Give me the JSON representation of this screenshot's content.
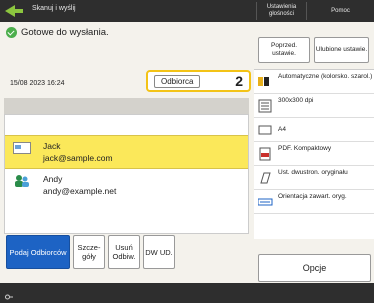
{
  "topbar": {
    "title": "Skanuj i wyślij",
    "settings_label": "Ustawienia głośności",
    "help_label": "Pomoc"
  },
  "status": {
    "text": "Gotowe do wysłania."
  },
  "datetime": "15/08 2023 16:24",
  "recipient": {
    "label": "Odbiorca",
    "count": "2"
  },
  "recipients": [
    {
      "name": "Jack",
      "address": "jack@sample.com",
      "selected": true
    },
    {
      "name": "Andy",
      "address": "andy@example.net",
      "selected": false
    }
  ],
  "bottom_buttons": {
    "specify": "Podaj Odbiorców",
    "details": "Szcze-góły",
    "delete": "Usuń Odbiw.",
    "cc_bcc": "DW UD."
  },
  "right_top": {
    "prev_settings": "Poprzed. ustawie.",
    "favorites": "Ulubione ustawie."
  },
  "settings": [
    {
      "icon": "color-mode-icon",
      "text": "Automatyczne (kolorsko. szarol.)"
    },
    {
      "icon": "resolution-icon",
      "text": "300x300 dpi"
    },
    {
      "icon": "paper-size-icon",
      "text": "A4"
    },
    {
      "icon": "file-format-icon",
      "text": "PDF. Kompaktowy"
    },
    {
      "icon": "duplex-icon",
      "text": "Ust. dwustron. oryginału"
    },
    {
      "icon": "orientation-icon",
      "text": "Orientacja zawart. oryg."
    }
  ],
  "options_label": "Opcje",
  "colors": {
    "primary_blue": "#1d63c4",
    "highlight_yellow": "#fbe85a",
    "status_green": "#4cae4c",
    "accent_border": "#f3c316"
  }
}
